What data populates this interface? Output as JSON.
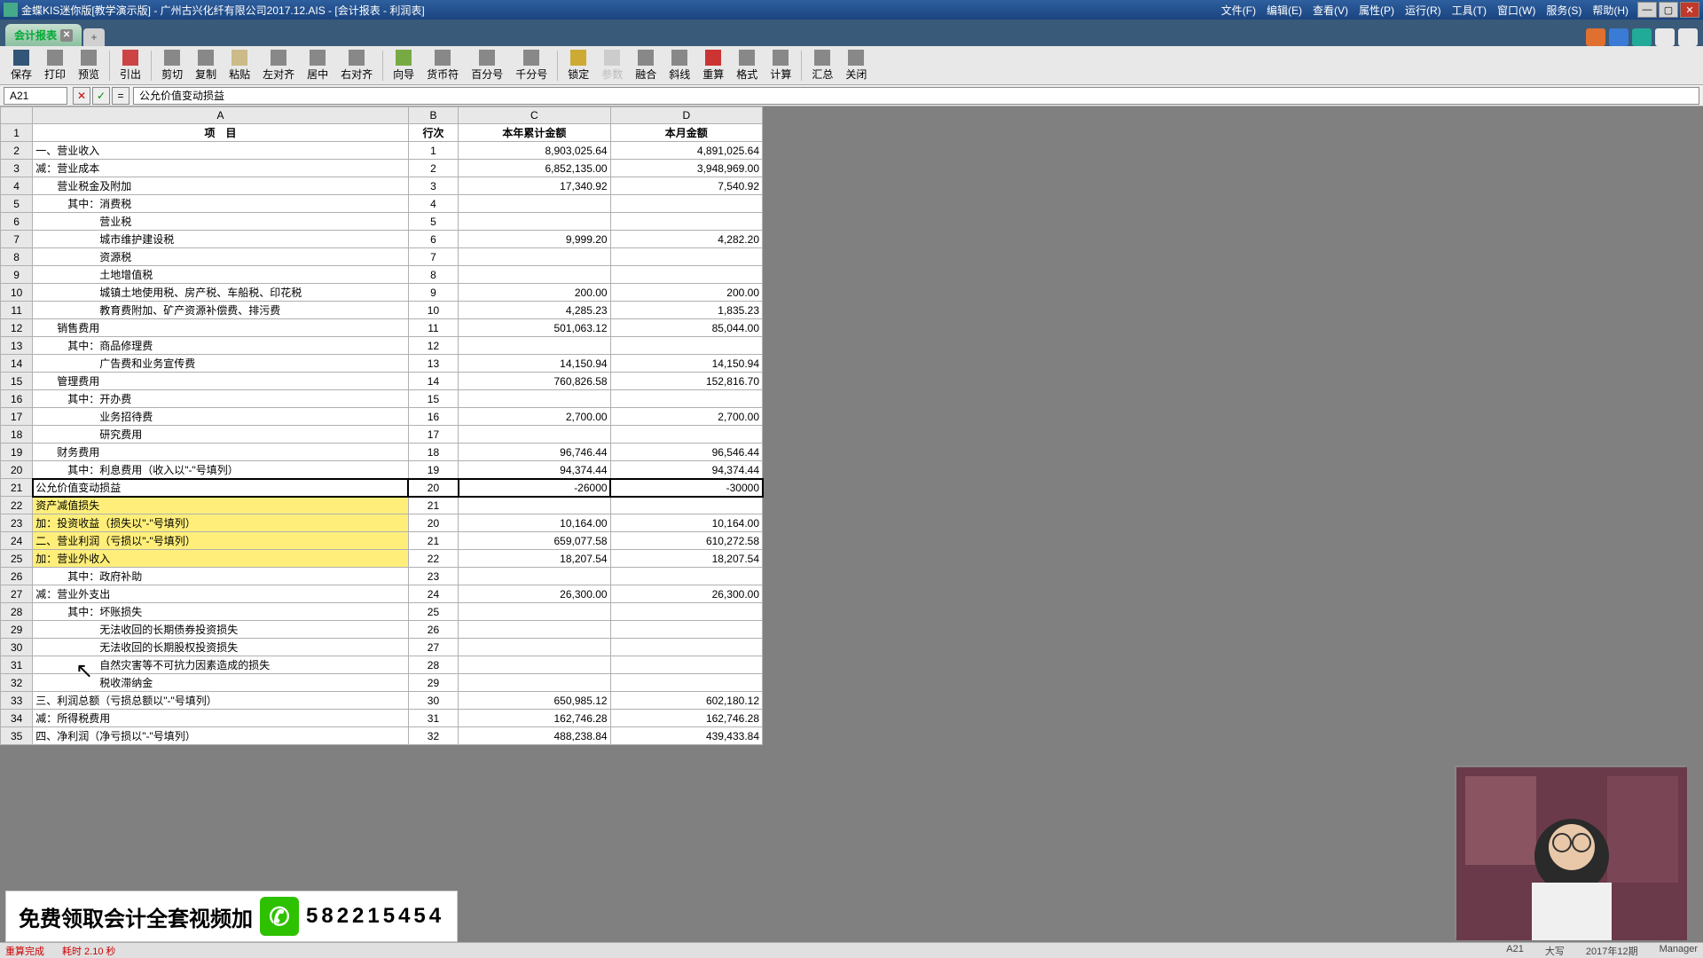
{
  "title": "金蝶KIS迷你版[教学演示版] - 广州古兴化纤有限公司2017.12.AIS - [会计报表 - 利润表]",
  "menus": [
    "文件(F)",
    "编辑(E)",
    "查看(V)",
    "属性(P)",
    "运行(R)",
    "工具(T)",
    "窗口(W)",
    "服务(S)",
    "帮助(H)"
  ],
  "tab_label": "会计报表",
  "cell_ref": "A21",
  "formula": "公允价值变动损益",
  "toolbar": [
    "保存",
    "打印",
    "预览",
    "引出",
    "剪切",
    "复制",
    "粘贴",
    "左对齐",
    "居中",
    "右对齐",
    "向导",
    "货币符",
    "百分号",
    "千分号",
    "锁定",
    "参数",
    "融合",
    "斜线",
    "重算",
    "格式",
    "计算",
    "汇总",
    "关闭"
  ],
  "col_headers": [
    "A",
    "B",
    "C",
    "D"
  ],
  "headers": {
    "item": "项　目",
    "line": "行次",
    "ytd": "本年累计金额",
    "month": "本月金额"
  },
  "rows": [
    {
      "r": 2,
      "a": "一、营业收入",
      "b": "1",
      "c": "8,903,025.64",
      "d": "4,891,025.64"
    },
    {
      "r": 3,
      "a": "减：营业成本",
      "b": "2",
      "c": "6,852,135.00",
      "d": "3,948,969.00"
    },
    {
      "r": 4,
      "a": "　　营业税金及附加",
      "b": "3",
      "c": "17,340.92",
      "d": "7,540.92"
    },
    {
      "r": 5,
      "a": "　　　其中：消费税",
      "b": "4",
      "c": "",
      "d": ""
    },
    {
      "r": 6,
      "a": "　　　　　　营业税",
      "b": "5",
      "c": "",
      "d": ""
    },
    {
      "r": 7,
      "a": "　　　　　　城市维护建设税",
      "b": "6",
      "c": "9,999.20",
      "d": "4,282.20"
    },
    {
      "r": 8,
      "a": "　　　　　　资源税",
      "b": "7",
      "c": "",
      "d": ""
    },
    {
      "r": 9,
      "a": "　　　　　　土地增值税",
      "b": "8",
      "c": "",
      "d": ""
    },
    {
      "r": 10,
      "a": "　　　　　　城镇土地使用税、房产税、车船税、印花税",
      "b": "9",
      "c": "200.00",
      "d": "200.00"
    },
    {
      "r": 11,
      "a": "　　　　　　教育费附加、矿产资源补偿费、排污费",
      "b": "10",
      "c": "4,285.23",
      "d": "1,835.23"
    },
    {
      "r": 12,
      "a": "　　销售费用",
      "b": "11",
      "c": "501,063.12",
      "d": "85,044.00"
    },
    {
      "r": 13,
      "a": "　　　其中：商品修理费",
      "b": "12",
      "c": "",
      "d": ""
    },
    {
      "r": 14,
      "a": "　　　　　　广告费和业务宣传费",
      "b": "13",
      "c": "14,150.94",
      "d": "14,150.94"
    },
    {
      "r": 15,
      "a": "　　管理费用",
      "b": "14",
      "c": "760,826.58",
      "d": "152,816.70"
    },
    {
      "r": 16,
      "a": "　　　其中：开办费",
      "b": "15",
      "c": "",
      "d": ""
    },
    {
      "r": 17,
      "a": "　　　　　　业务招待费",
      "b": "16",
      "c": "2,700.00",
      "d": "2,700.00"
    },
    {
      "r": 18,
      "a": "　　　　　　研究费用",
      "b": "17",
      "c": "",
      "d": ""
    },
    {
      "r": 19,
      "a": "　　财务费用",
      "b": "18",
      "c": "96,746.44",
      "d": "96,546.44"
    },
    {
      "r": 20,
      "a": "　　　其中：利息费用（收入以\"-\"号填列）",
      "b": "19",
      "c": "94,374.44",
      "d": "94,374.44"
    },
    {
      "r": 21,
      "a": "公允价值变动损益",
      "b": "20",
      "c": "-26000",
      "d": "-30000",
      "sel": true
    },
    {
      "r": 22,
      "a": "资产减值损失",
      "b": "21",
      "c": "",
      "d": "",
      "hl": true
    },
    {
      "r": 23,
      "a": "加：投资收益（损失以\"-\"号填列）",
      "b": "20",
      "c": "10,164.00",
      "d": "10,164.00",
      "hl": true
    },
    {
      "r": 24,
      "a": "二、营业利润（亏损以\"-\"号填列）",
      "b": "21",
      "c": "659,077.58",
      "d": "610,272.58",
      "hl": true
    },
    {
      "r": 25,
      "a": "加：营业外收入",
      "b": "22",
      "c": "18,207.54",
      "d": "18,207.54",
      "hl": true
    },
    {
      "r": 26,
      "a": "　　　其中：政府补助",
      "b": "23",
      "c": "",
      "d": ""
    },
    {
      "r": 27,
      "a": "减：营业外支出",
      "b": "24",
      "c": "26,300.00",
      "d": "26,300.00"
    },
    {
      "r": 28,
      "a": "　　　其中：坏账损失",
      "b": "25",
      "c": "",
      "d": ""
    },
    {
      "r": 29,
      "a": "　　　　　　无法收回的长期债券投资损失",
      "b": "26",
      "c": "",
      "d": ""
    },
    {
      "r": 30,
      "a": "　　　　　　无法收回的长期股权投资损失",
      "b": "27",
      "c": "",
      "d": ""
    },
    {
      "r": 31,
      "a": "　　　　　　自然灾害等不可抗力因素造成的损失",
      "b": "28",
      "c": "",
      "d": ""
    },
    {
      "r": 32,
      "a": "　　　　　　税收滞纳金",
      "b": "29",
      "c": "",
      "d": ""
    },
    {
      "r": 33,
      "a": "三、利润总额（亏损总额以\"-\"号填列）",
      "b": "30",
      "c": "650,985.12",
      "d": "602,180.12"
    },
    {
      "r": 34,
      "a": "减：所得税费用",
      "b": "31",
      "c": "162,746.28",
      "d": "162,746.28"
    },
    {
      "r": 35,
      "a": "四、净利润（净亏损以\"-\"号填列）",
      "b": "32",
      "c": "488,238.84",
      "d": "439,433.84"
    }
  ],
  "status": {
    "left1": "重算完成",
    "left2": "耗时 2.10 秒",
    "cell": "A21",
    "recalc": "大写",
    "period": "2017年12期",
    "user": "Manager"
  },
  "ad": {
    "text1": "免费领取会计全套视频加",
    "text2": "582215454"
  }
}
